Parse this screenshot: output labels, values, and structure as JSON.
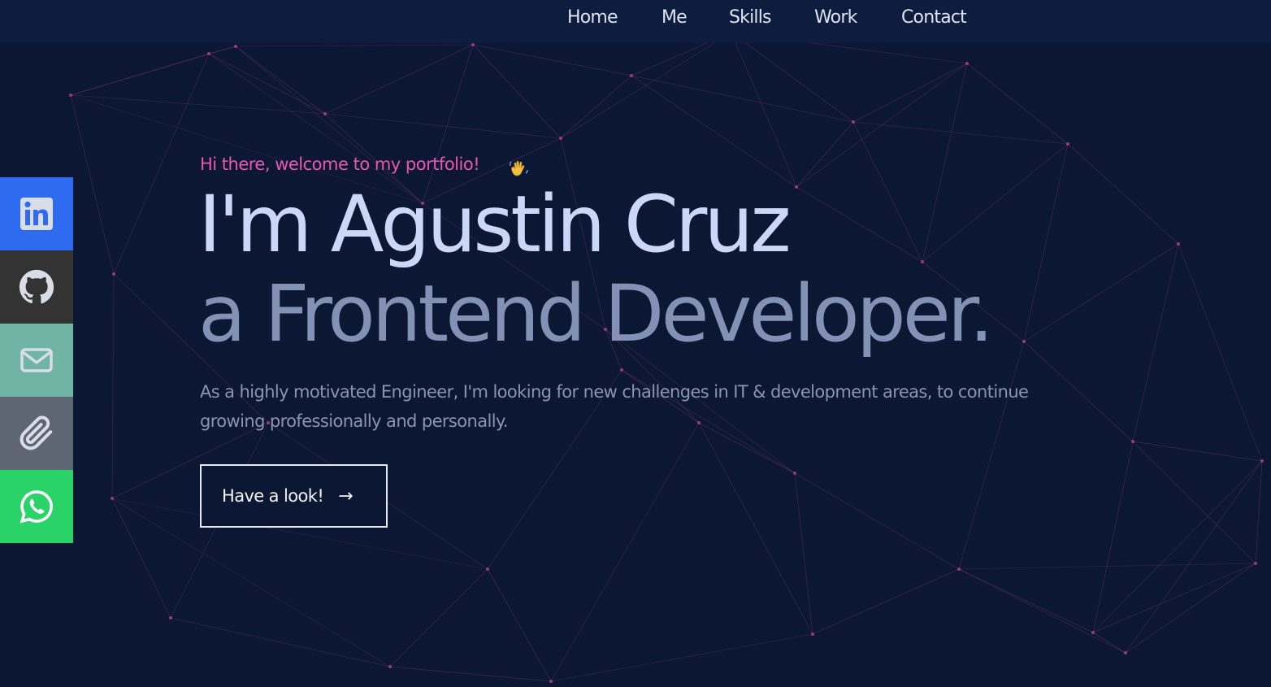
{
  "nav": {
    "items": [
      {
        "label": "Home"
      },
      {
        "label": "Me"
      },
      {
        "label": "Skills"
      },
      {
        "label": "Work"
      },
      {
        "label": "Contact"
      }
    ]
  },
  "social": [
    {
      "icon": "linkedin-icon",
      "color": "#2f6bf0"
    },
    {
      "icon": "github-icon",
      "color": "#333333"
    },
    {
      "icon": "mail-icon",
      "color": "#6fb4a4"
    },
    {
      "icon": "paperclip-icon",
      "color": "#5e6573"
    },
    {
      "icon": "whatsapp-icon",
      "color": "#29d367"
    }
  ],
  "hero": {
    "greeting": "Hi there, welcome to my portfolio!",
    "greeting_emoji": "waving-hand-icon",
    "name_line": "I'm Agustin Cruz",
    "role_line": "a Frontend Developer.",
    "description": "As a highly motivated Engineer, I'm looking for new challenges in IT & development areas, to continue growing professionally and personally.",
    "cta_label": "Have a look!",
    "cta_icon": "arrow-right-icon"
  },
  "colors": {
    "background": "#0c1833",
    "accent": "#e857b0",
    "name": "#ccd6f6",
    "role": "#8391b4"
  }
}
